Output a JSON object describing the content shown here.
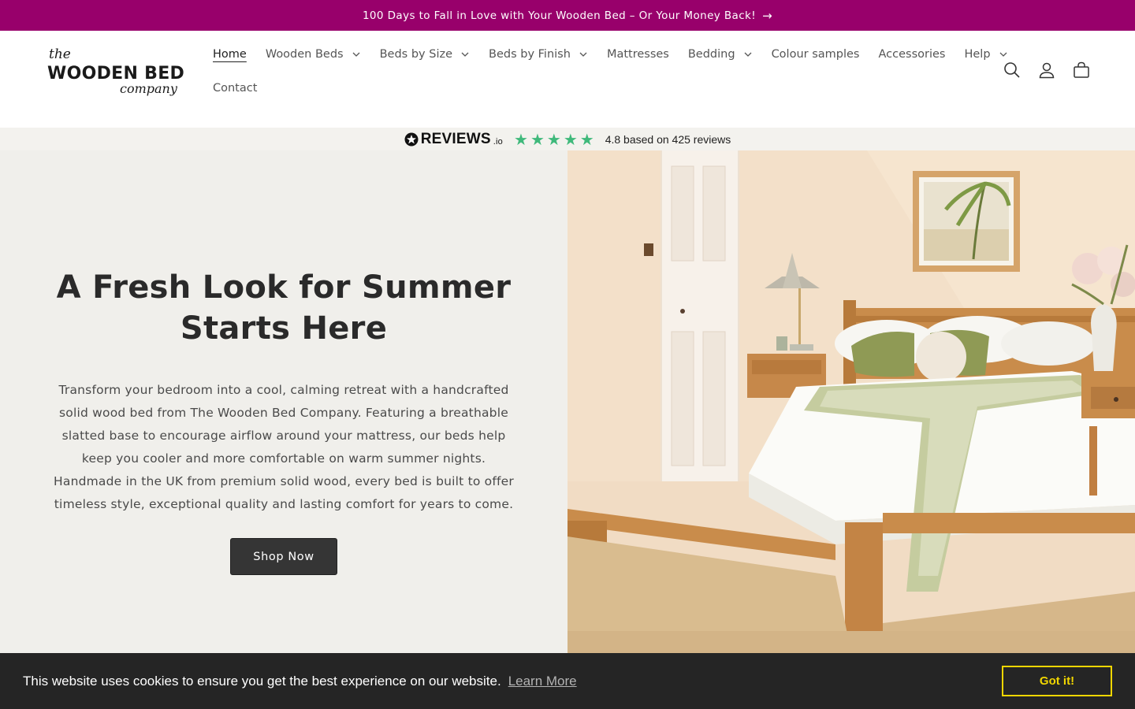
{
  "announcement": {
    "text": "100 Days to Fall in Love with Your Wooden Bed – Or Your Money Back!",
    "arrow": "→"
  },
  "logo": {
    "the": "the",
    "main": "WOODEN BED",
    "company": "company"
  },
  "nav": {
    "row1": [
      {
        "label": "Home",
        "active": true,
        "dropdown": false
      },
      {
        "label": "Wooden Beds",
        "dropdown": true
      },
      {
        "label": "Beds by Size",
        "dropdown": true
      },
      {
        "label": "Beds by Finish",
        "dropdown": true
      },
      {
        "label": "Mattresses",
        "dropdown": false
      },
      {
        "label": "Bedding",
        "dropdown": true
      },
      {
        "label": "Colour samples",
        "dropdown": false
      },
      {
        "label": "Accessories",
        "dropdown": false
      },
      {
        "label": "Help",
        "dropdown": true
      }
    ],
    "row2": [
      {
        "label": "Contact",
        "dropdown": false
      }
    ]
  },
  "header_icons": [
    "search-icon",
    "account-icon",
    "cart-icon"
  ],
  "reviews": {
    "brand": "REVIEWS",
    "brand_suffix": ".io",
    "stars": 5,
    "summary": "4.8 based on 425 reviews",
    "star_color": "#3fb97b"
  },
  "hero": {
    "title": "A Fresh Look for Summer Starts Here",
    "text": "Transform your bedroom into a cool, calming retreat with a handcrafted solid wood bed from The Wooden Bed Company. Featuring a breathable slatted base to encourage airflow around your mattress, our beds help keep you cooler and more comfortable on warm summer nights. Handmade in the UK from premium solid wood, every bed is built to offer timeless style, exceptional quality and lasting comfort for years to come.",
    "button": "Shop Now"
  },
  "cookie": {
    "message": "This website uses cookies to ensure you get the best experience on our website.",
    "learn_more": "Learn More",
    "accept": "Got it!"
  },
  "colors": {
    "announcement_bg": "#98006b",
    "hero_bg": "#f0efeb",
    "button_bg": "#353535",
    "cookie_bg": "#252525",
    "cookie_accent": "#f1d600"
  }
}
